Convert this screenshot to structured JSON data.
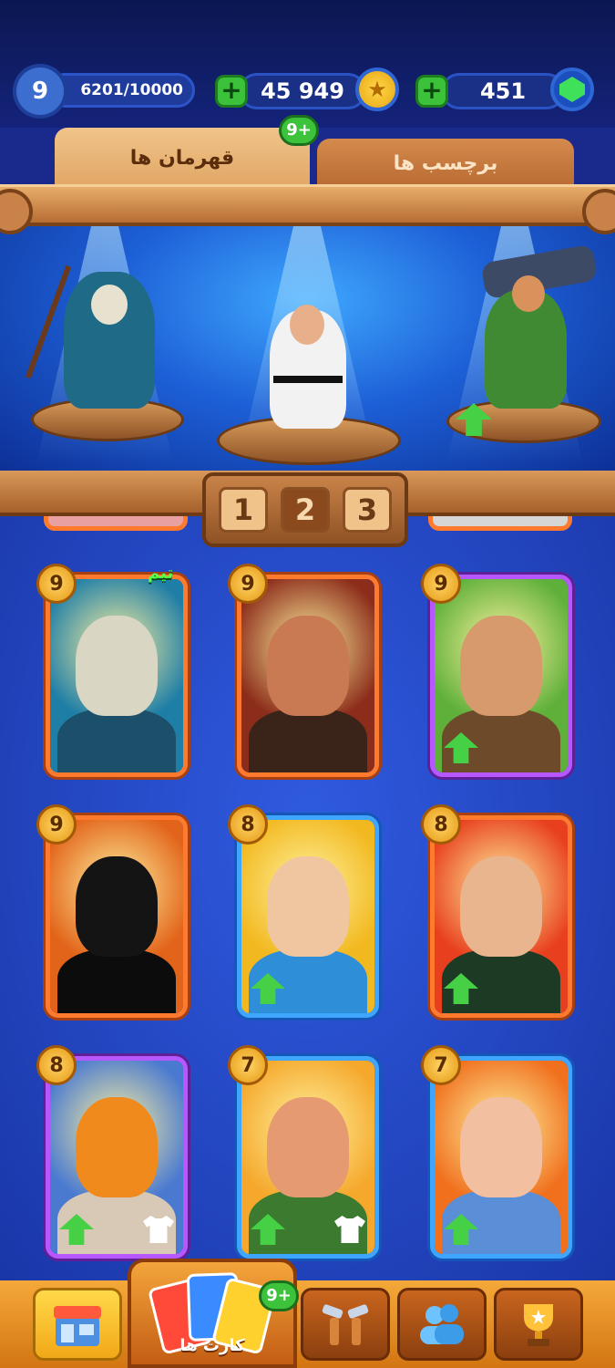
{
  "hud": {
    "level": "9",
    "xp": "6201/10000",
    "coins": "45 949",
    "gems": "451",
    "plus": "+",
    "coin_symbol": "★"
  },
  "tabs": {
    "heroes": "قهرمان ها",
    "stickers": "برچسب ها",
    "badge": "9+"
  },
  "pager": {
    "pages": [
      "1",
      "2",
      "3"
    ],
    "active": "2"
  },
  "cards": [
    {
      "level": "9",
      "team": "تیم",
      "frame": "orange",
      "bg": "#1f7ea6",
      "face": "#d9d6c4",
      "body": "#1c4f6a",
      "upgrade": false,
      "outfit": false
    },
    {
      "level": "9",
      "team": "",
      "frame": "orange",
      "bg": "#8c2c1a",
      "face": "#c97a53",
      "body": "#3a241a",
      "upgrade": false,
      "outfit": false
    },
    {
      "level": "9",
      "team": "",
      "frame": "purple",
      "bg": "#5fb03a",
      "face": "#d79a6c",
      "body": "#6d4a2a",
      "upgrade": true,
      "outfit": false
    },
    {
      "level": "9",
      "team": "",
      "frame": "orange",
      "bg": "#e2641a",
      "face": "#141414",
      "body": "#0c0c0c",
      "upgrade": false,
      "outfit": false
    },
    {
      "level": "8",
      "team": "",
      "frame": "blue",
      "bg": "#f2b81f",
      "face": "#f0c6a0",
      "body": "#2e8fd8",
      "upgrade": true,
      "outfit": false
    },
    {
      "level": "8",
      "team": "",
      "frame": "orange",
      "bg": "#e8401e",
      "face": "#e8b58f",
      "body": "#1d3a24",
      "upgrade": true,
      "outfit": false
    },
    {
      "level": "8",
      "team": "",
      "frame": "purple",
      "bg": "#4a7ad0",
      "face": "#f08a1c",
      "body": "#d8c9b7",
      "upgrade": true,
      "outfit": true
    },
    {
      "level": "7",
      "team": "",
      "frame": "blue",
      "bg": "#f5a82c",
      "face": "#e59a72",
      "body": "#3c7a30",
      "upgrade": true,
      "outfit": true
    },
    {
      "level": "7",
      "team": "",
      "frame": "blue",
      "bg": "#f0701e",
      "face": "#f2c0a0",
      "body": "#5a8fd8",
      "upgrade": true,
      "outfit": false
    }
  ],
  "nav": {
    "cards_label": "کارت ها",
    "cards_badge": "9+"
  },
  "colors": {
    "accent_green": "#3cc23a",
    "wood": "#c98349",
    "background": "#1a36a8"
  }
}
